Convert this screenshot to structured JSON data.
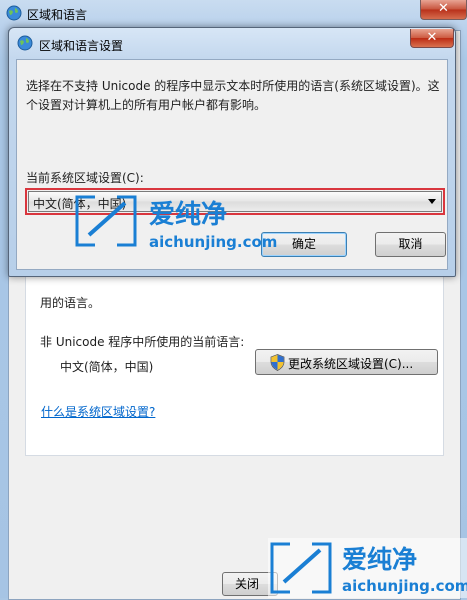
{
  "parent_window": {
    "title": "区域和语言",
    "close_glyph": "✕",
    "partial_text": "用的语言。",
    "nonunicode_label": "非 Unicode 程序中所使用的当前语言:",
    "current_language": "中文(简体，中国)",
    "change_locale_button": "更改系统区域设置(C)...",
    "link": "什么是系统区域设置?",
    "close_button": "关闭"
  },
  "dialog": {
    "title": "区域和语言设置",
    "close_glyph": "✕",
    "description": "选择在不支持 Unicode 的程序中显示文本时所使用的语言(系统区域设置)。这个设置对计算机上的所有用户帐户都有影响。",
    "current_locale_label": "当前系统区域设置(C):",
    "selected_locale": "中文(简体，中国)",
    "ok_button": "确定",
    "cancel_button": "取消"
  },
  "watermark": {
    "brand": "爱纯净",
    "url": "aichunjing.com"
  },
  "icons": {
    "title_icon": "globe-icon",
    "uac": "shield-icon",
    "dropdown": "chevron-down-icon"
  },
  "colors": {
    "highlight": "#d9363e",
    "link": "#0066cc",
    "accent": "#1a7fd4"
  }
}
